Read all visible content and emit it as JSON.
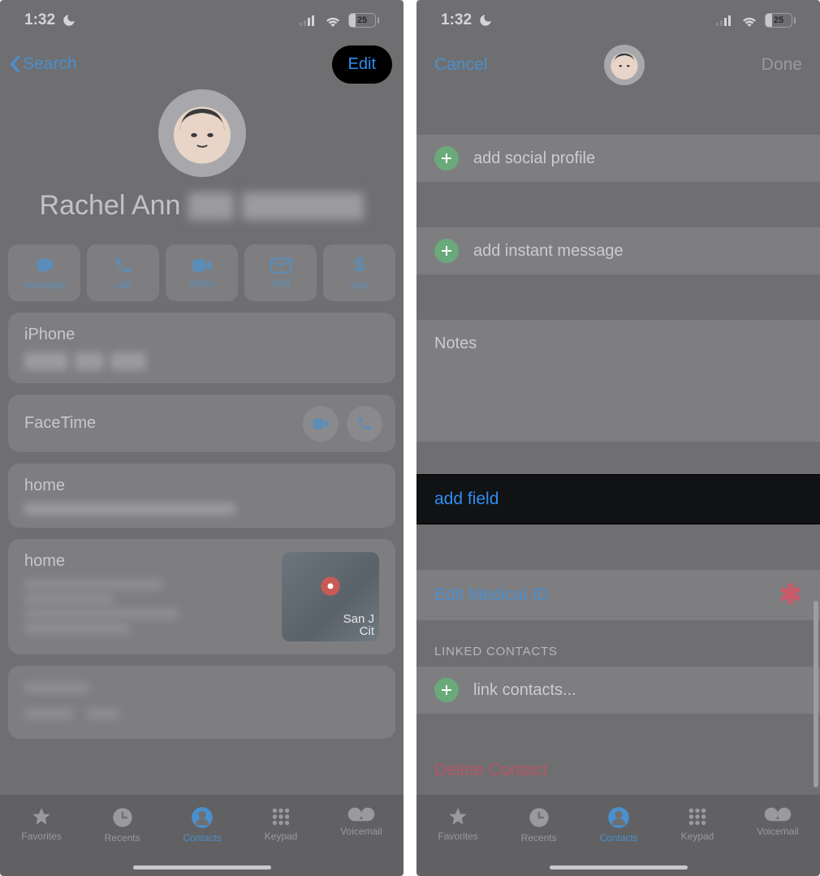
{
  "status": {
    "time": "1:32",
    "battery": "25"
  },
  "left": {
    "back": "Search",
    "edit": "Edit",
    "contact_name_visible": "Rachel Ann",
    "quick_actions": [
      {
        "id": "message",
        "label": "message"
      },
      {
        "id": "call",
        "label": "call"
      },
      {
        "id": "video",
        "label": "video"
      },
      {
        "id": "mail",
        "label": "mail"
      },
      {
        "id": "pay",
        "label": "pay"
      }
    ],
    "phone_label": "iPhone",
    "facetime_label": "FaceTime",
    "email_label": "home",
    "address_label": "home",
    "map_city": "San J",
    "map_suffix": "Cit"
  },
  "right": {
    "cancel": "Cancel",
    "done": "Done",
    "add_social": "add social profile",
    "add_im": "add instant message",
    "notes": "Notes",
    "add_field": "add field",
    "edit_medical": "Edit Medical ID",
    "linked_hd": "LINKED CONTACTS",
    "link_contacts": "link contacts...",
    "delete": "Delete Contact"
  },
  "tabs": [
    {
      "id": "favorites",
      "label": "Favorites"
    },
    {
      "id": "recents",
      "label": "Recents"
    },
    {
      "id": "contacts",
      "label": "Contacts",
      "active": true
    },
    {
      "id": "keypad",
      "label": "Keypad"
    },
    {
      "id": "voicemail",
      "label": "Voicemail"
    }
  ]
}
